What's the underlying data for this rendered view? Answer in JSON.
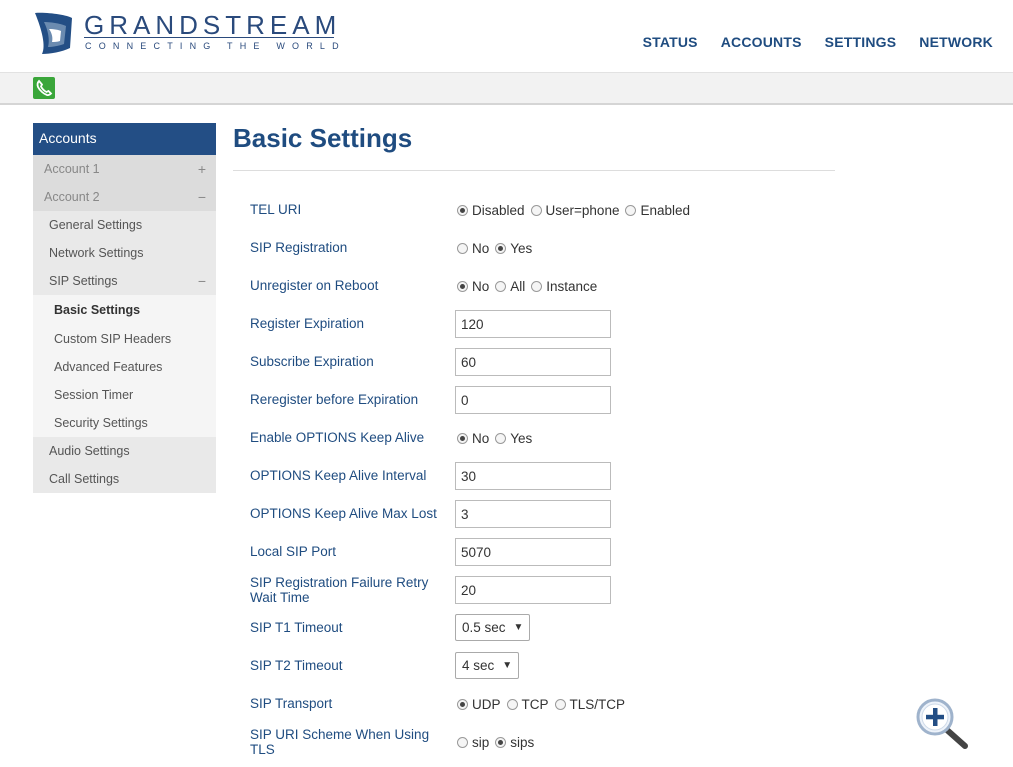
{
  "brand": {
    "name": "GRANDSTREAM",
    "tagline": "CONNECTING THE WORLD",
    "colors": {
      "primary": "#234e85",
      "link": "#1f4c80",
      "call_green": "#3aa63a"
    }
  },
  "topnav": [
    "STATUS",
    "ACCOUNTS",
    "SETTINGS",
    "NETWORK"
  ],
  "toolbar": {
    "icon": "phone-icon"
  },
  "sidebar": {
    "title": "Accounts",
    "items": [
      {
        "label": "Account 1",
        "level": 1,
        "toggle": "+"
      },
      {
        "label": "Account 2",
        "level": 1,
        "toggle": "−"
      },
      {
        "label": "General Settings",
        "level": 2
      },
      {
        "label": "Network Settings",
        "level": 2
      },
      {
        "label": "SIP Settings",
        "level": 2,
        "toggle": "−"
      },
      {
        "label": "Basic Settings",
        "level": 3,
        "active": true
      },
      {
        "label": "Custom SIP Headers",
        "level": 3
      },
      {
        "label": "Advanced Features",
        "level": 3
      },
      {
        "label": "Session Timer",
        "level": 3
      },
      {
        "label": "Security Settings",
        "level": 3
      },
      {
        "label": "Audio Settings",
        "level": 2
      },
      {
        "label": "Call Settings",
        "level": 2
      }
    ]
  },
  "main": {
    "title": "Basic Settings",
    "fields": {
      "tel_uri": {
        "label": "TEL URI",
        "options": [
          "Disabled",
          "User=phone",
          "Enabled"
        ],
        "selected": "Disabled"
      },
      "sip_registration": {
        "label": "SIP Registration",
        "options": [
          "No",
          "Yes"
        ],
        "selected": "Yes"
      },
      "unregister_on_reboot": {
        "label": "Unregister on Reboot",
        "options": [
          "No",
          "All",
          "Instance"
        ],
        "selected": "No"
      },
      "register_expiration": {
        "label": "Register Expiration",
        "value": "120"
      },
      "subscribe_expiration": {
        "label": "Subscribe Expiration",
        "value": "60"
      },
      "reregister_before_expiration": {
        "label": "Reregister before Expiration",
        "value": "0"
      },
      "enable_options_keep_alive": {
        "label": "Enable OPTIONS Keep Alive",
        "options": [
          "No",
          "Yes"
        ],
        "selected": "No"
      },
      "options_keep_alive_interval": {
        "label": "OPTIONS Keep Alive Interval",
        "value": "30"
      },
      "options_keep_alive_max_lost": {
        "label": "OPTIONS Keep Alive Max Lost",
        "value": "3"
      },
      "local_sip_port": {
        "label": "Local SIP Port",
        "value": "5070"
      },
      "sip_reg_failure_retry_wait": {
        "label": "SIP Registration Failure Retry Wait Time",
        "value": "20"
      },
      "sip_t1_timeout": {
        "label": "SIP T1 Timeout",
        "value": "0.5 sec"
      },
      "sip_t2_timeout": {
        "label": "SIP T2 Timeout",
        "value": "4 sec"
      },
      "sip_transport": {
        "label": "SIP Transport",
        "options": [
          "UDP",
          "TCP",
          "TLS/TCP"
        ],
        "selected": "UDP"
      },
      "sip_uri_scheme_tls": {
        "label": "SIP URI Scheme When Using TLS",
        "options": [
          "sip",
          "sips"
        ],
        "selected": "sips"
      }
    }
  },
  "zoom_button": {
    "icon": "zoom-in-icon"
  }
}
